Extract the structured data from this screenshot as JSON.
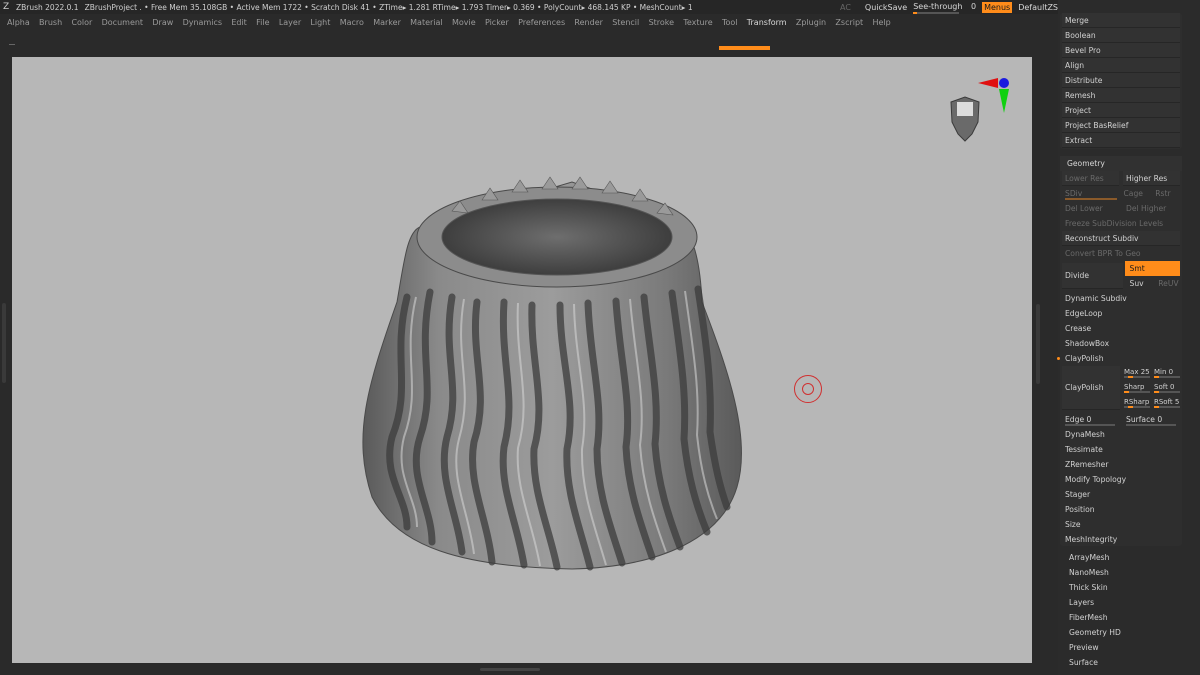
{
  "titlebar": {
    "app": "ZBrush 2022.0.1",
    "status": "ZBrushProject   . • Free Mem 35.108GB • Active Mem 1722 • Scratch Disk 41 •  ZTime▸ 1.281 RTime▸ 1.793 Timer▸ 0.369 • PolyCount▸ 468.145 KP  • MeshCount▸ 1",
    "ac": "AC",
    "quicksave": "QuickSave",
    "see_through_label": "See-through",
    "see_through_value": "0",
    "menus": "Menus",
    "script": "DefaultZScript"
  },
  "menubar": [
    "Alpha",
    "Brush",
    "Color",
    "Document",
    "Draw",
    "Dynamics",
    "Edit",
    "File",
    "Layer",
    "Light",
    "Macro",
    "Marker",
    "Material",
    "Movie",
    "Picker",
    "Preferences",
    "Render",
    "Stencil",
    "Stroke",
    "Texture",
    "Tool",
    "Transform",
    "Zplugin",
    "Zscript",
    "Help"
  ],
  "active_menu": "Transform",
  "panel": {
    "top_group": [
      "Merge",
      "Boolean",
      "Bevel Pro",
      "Align",
      "Distribute",
      "Remesh",
      "Project",
      "Project BasRelief",
      "Extract"
    ],
    "geometry": {
      "header": "Geometry",
      "lower_res": "Lower Res",
      "higher_res": "Higher Res",
      "sdiv": "SDiv",
      "cage": "Cage",
      "rstr": "Rstr",
      "del_lower": "Del Lower",
      "del_higher": "Del Higher",
      "freeze": "Freeze SubDivision Levels",
      "reconstruct": "Reconstruct Subdiv",
      "convert_bpr": "Convert BPR To Geo",
      "divide": "Divide",
      "smt": "Smt",
      "suv": "Suv",
      "reuv": "ReUV",
      "dynamic_subdiv": "Dynamic Subdiv",
      "edgeloop": "EdgeLoop",
      "crease": "Crease",
      "shadowbox": "ShadowBox",
      "claypolish": "ClayPolish",
      "claypolish_btn": "ClayPolish",
      "max": "Max 25",
      "min": "Min 0",
      "sharp": "Sharp",
      "soft": "Soft 0",
      "rsharp": "RSharp",
      "rsoft": "RSoft 5",
      "edge": "Edge 0",
      "surface": "Surface 0",
      "rest": [
        "DynaMesh",
        "Tessimate",
        "ZRemesher",
        "Modify Topology",
        "Stager",
        "Position",
        "Size",
        "MeshIntegrity"
      ]
    },
    "bottom_group": [
      "ArrayMesh",
      "NanoMesh",
      "Thick Skin",
      "Layers",
      "FiberMesh",
      "Geometry HD",
      "Preview",
      "Surface"
    ]
  },
  "colors": {
    "accent": "#ff8c1a",
    "viewport_bg": "#b7b7b7",
    "panel_bg": "#2b2b2b"
  }
}
